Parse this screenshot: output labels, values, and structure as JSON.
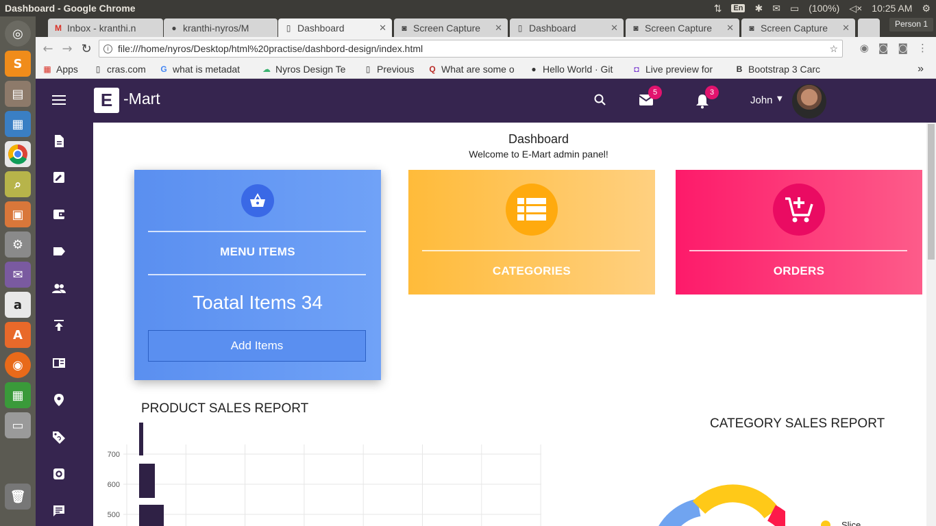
{
  "os": {
    "window_title": "Dashboard - Google Chrome",
    "lang": "En",
    "battery": "(100%)",
    "time": "10:25 AM"
  },
  "browser": {
    "tabs": [
      {
        "label": "Inbox - kranthi.n",
        "icon": "gmail-icon"
      },
      {
        "label": "kranthi-nyros/M",
        "icon": "github-icon"
      },
      {
        "label": "Dashboard",
        "icon": "page-icon"
      },
      {
        "label": "Screen Capture",
        "icon": "camera-icon"
      },
      {
        "label": "Dashboard",
        "icon": "page-icon"
      },
      {
        "label": "Screen Capture",
        "icon": "camera-icon"
      },
      {
        "label": "Screen Capture",
        "icon": "camera-icon"
      }
    ],
    "active_tab": 2,
    "profile": "Person 1",
    "url": "file:///home/nyros/Desktop/html%20practise/dashbord-design/index.html",
    "bookmarks": [
      {
        "label": "Apps",
        "icon": "apps-grid-icon"
      },
      {
        "label": "cras.com",
        "icon": "page-icon"
      },
      {
        "label": "what is metadat",
        "icon": "google-icon"
      },
      {
        "label": "Nyros Design Te",
        "icon": "cloud-icon"
      },
      {
        "label": "Previous",
        "icon": "page-icon"
      },
      {
        "label": "What are some o",
        "icon": "quora-icon"
      },
      {
        "label": "Hello World · Git",
        "icon": "github-icon"
      },
      {
        "label": "Live preview for",
        "icon": "preview-icon"
      },
      {
        "label": "Bootstrap 3 Carc",
        "icon": "bootstrap-icon"
      }
    ]
  },
  "app": {
    "brand_letter": "E",
    "brand_text": "-Mart",
    "mail_count": "5",
    "notif_count": "3",
    "user_name": "John",
    "colors": {
      "header": "#36254f",
      "badge": "#e2136e",
      "blue": "#5a8ff0",
      "orange": "#ffbb3a",
      "pink": "#fd1a6a"
    },
    "sidebar": [
      "document-icon",
      "edit-icon",
      "wallet-icon",
      "label-icon",
      "people-icon",
      "upload-icon",
      "news-icon",
      "location-icon",
      "tag-icon",
      "settings-icon",
      "chat-icon"
    ]
  },
  "page": {
    "title": "Dashboard",
    "subtitle": "Welcome to E-Mart admin panel!",
    "cards": {
      "menu": {
        "label": "MENU ITEMS",
        "total": "Toatal Items 34",
        "button": "Add Items"
      },
      "categories": {
        "label": "CATEGORIES"
      },
      "orders": {
        "label": "ORDERS"
      }
    },
    "product_report_title": "PRODUCT SALES REPORT",
    "category_report_title": "CATEGORY SALES REPORT",
    "legend_label": "Slice"
  },
  "chart_data": [
    {
      "type": "bar",
      "title": "PRODUCT SALES REPORT",
      "orientation": "horizontal",
      "ticks_y": [
        "700",
        "600",
        "500"
      ],
      "grid": true,
      "visible_bars": [
        {
          "value": 6
        },
        {
          "value": 23
        },
        {
          "value": 36
        }
      ]
    },
    {
      "type": "pie",
      "title": "CATEGORY SALES REPORT",
      "legend": [
        "Slice"
      ],
      "legend_position": "right"
    }
  ]
}
